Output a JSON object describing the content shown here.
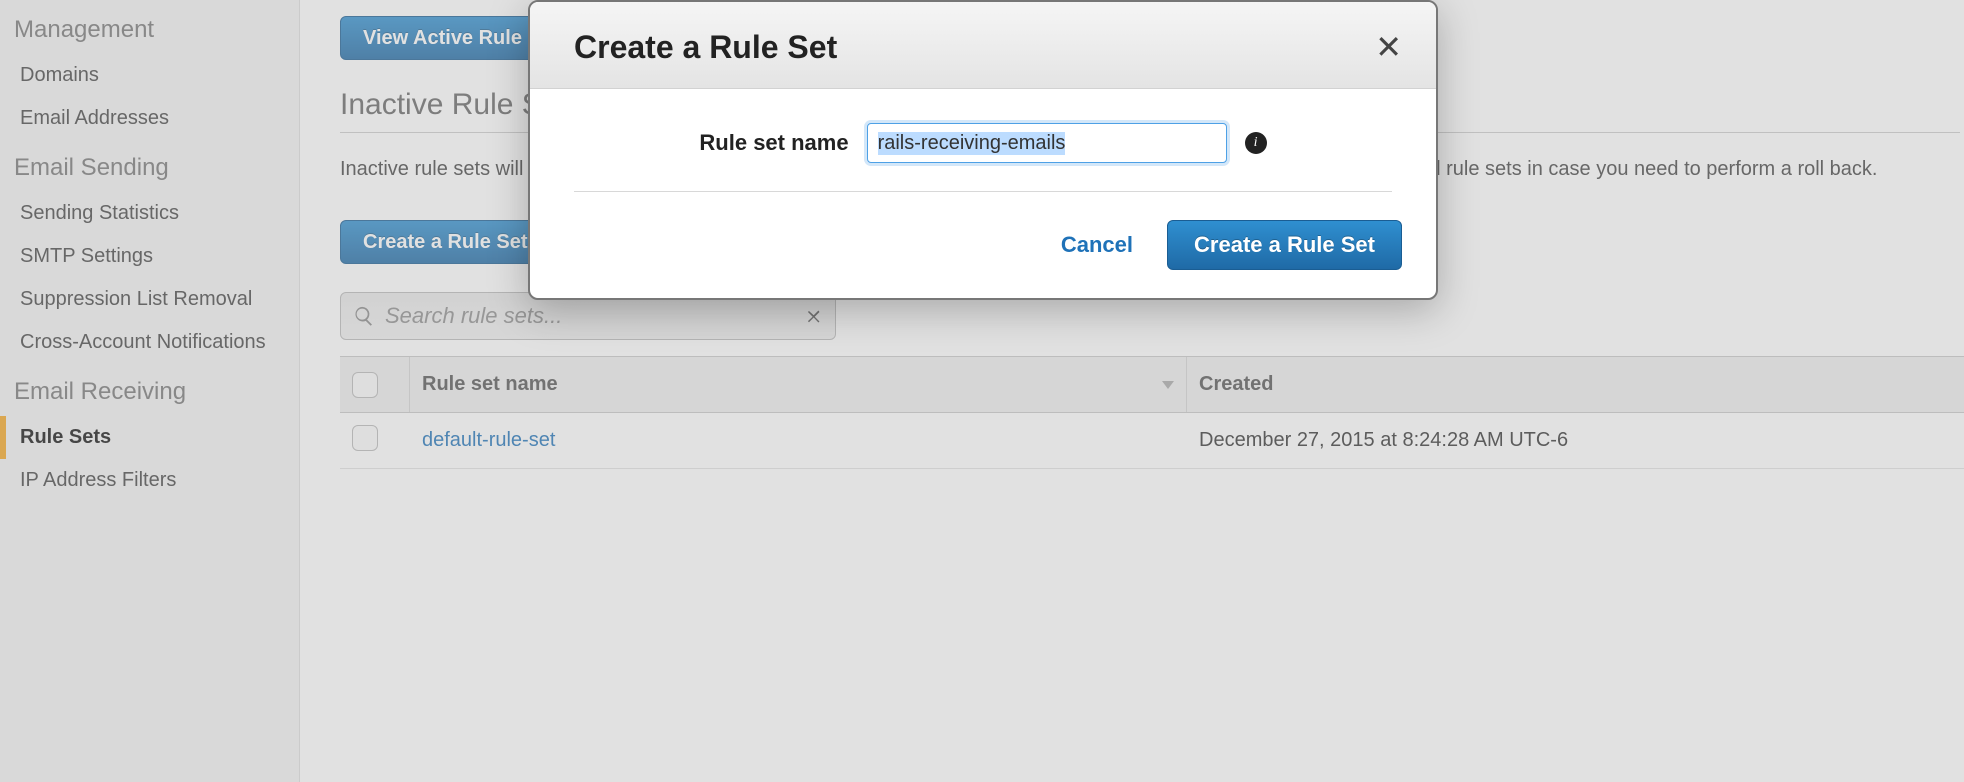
{
  "sidebar": {
    "groups": [
      {
        "title": "Management",
        "items": [
          "Domains",
          "Email Addresses"
        ]
      },
      {
        "title": "Email Sending",
        "items": [
          "Sending Statistics",
          "SMTP Settings",
          "Suppression List Removal",
          "Cross-Account Notifications"
        ]
      },
      {
        "title": "Email Receiving",
        "items": [
          "Rule Sets",
          "IP Address Filters"
        ],
        "active_index": 0
      }
    ]
  },
  "main": {
    "view_active_btn": "View Active Rule Set",
    "page_title": "Inactive Rule Sets",
    "page_desc": "Inactive rule sets will not be applied to your incoming emails. You can use inactive rule sets to test a new rule set or store old rule sets in case you need to perform a roll back.",
    "create_btn": "Create a Rule Set",
    "search_placeholder": "Search rule sets...",
    "table": {
      "col_name": "Rule set name",
      "col_created": "Created",
      "rows": [
        {
          "name": "default-rule-set",
          "created": "December 27, 2015 at 8:24:28 AM UTC-6"
        }
      ]
    }
  },
  "modal": {
    "title": "Create a Rule Set",
    "label": "Rule set name",
    "value": "rails-receiving-emails",
    "cancel": "Cancel",
    "submit": "Create a Rule Set"
  }
}
